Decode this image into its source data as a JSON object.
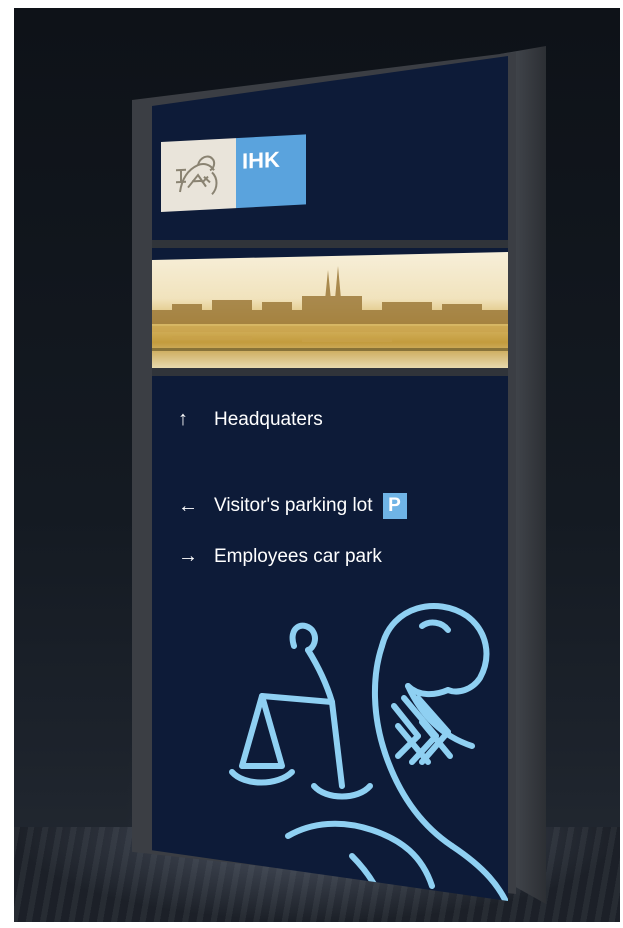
{
  "sign": {
    "logo": {
      "text": "IHK",
      "emblem": "ihk-lion-emblem-icon"
    },
    "photo": "city-skyline-panorama",
    "directions": [
      {
        "arrow": "↑",
        "arrow_icon": "arrow-up-icon",
        "label": "Headquaters"
      },
      {
        "arrow": "←",
        "arrow_icon": "arrow-left-icon",
        "label": "Visitor's parking lot",
        "badge": "P"
      },
      {
        "arrow": "→",
        "arrow_icon": "arrow-right-icon",
        "label": "Employees car park"
      }
    ],
    "mascot": "lion-with-scales-icon"
  },
  "colors": {
    "panel": "#0d1b38",
    "accent_blue": "#5aa3dd",
    "line_art": "#8fd0f2"
  }
}
